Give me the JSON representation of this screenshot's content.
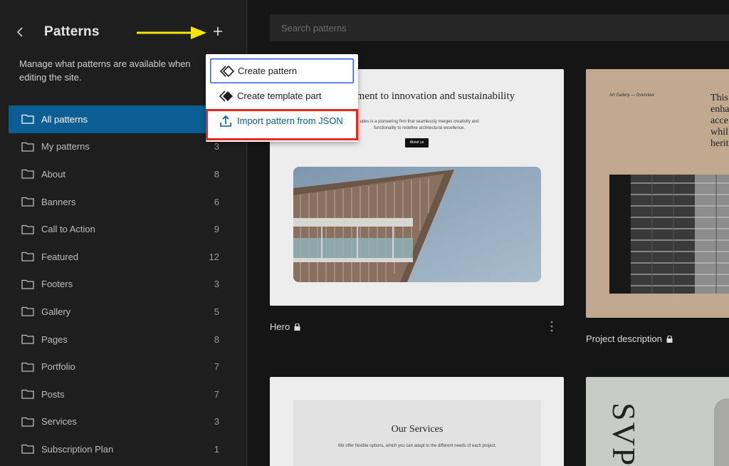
{
  "sidebar": {
    "back_icon": "chevron-left-icon",
    "title": "Patterns",
    "add_icon": "plus-icon",
    "description": "Manage what patterns are available when editing the site.",
    "items": [
      {
        "label": "All patterns",
        "count": "",
        "active": true
      },
      {
        "label": "My patterns",
        "count": "3"
      },
      {
        "label": "About",
        "count": "8"
      },
      {
        "label": "Banners",
        "count": "6"
      },
      {
        "label": "Call to Action",
        "count": "9"
      },
      {
        "label": "Featured",
        "count": "12"
      },
      {
        "label": "Footers",
        "count": "3"
      },
      {
        "label": "Gallery",
        "count": "5"
      },
      {
        "label": "Pages",
        "count": "8"
      },
      {
        "label": "Portfolio",
        "count": "7"
      },
      {
        "label": "Posts",
        "count": "7"
      },
      {
        "label": "Services",
        "count": "3"
      },
      {
        "label": "Subscription Plan",
        "count": "1"
      }
    ]
  },
  "annotation": {
    "arrow_color": "#f7e600",
    "highlight_color": "#e8271f"
  },
  "dropdown": {
    "items": [
      {
        "label": "Create pattern",
        "icon": "pattern-icon"
      },
      {
        "label": "Create template part",
        "icon": "template-part-icon"
      },
      {
        "label": "Import pattern from JSON",
        "icon": "upload-icon"
      }
    ]
  },
  "main": {
    "search_placeholder": "Search patterns",
    "cards": {
      "hero": {
        "label": "Hero",
        "heading": "commitment to innovation and sustainability",
        "sub": "udes is a pioneering firm that seamlessly merges creativity and functionality to redefine architectural excellence.",
        "button": "About us"
      },
      "project": {
        "label": "Project description",
        "kicker": "Art Gallery — Overview",
        "text_lines": [
          "This",
          "enha",
          "acce",
          "whil",
          "herit"
        ]
      },
      "services": {
        "heading": "Our Services",
        "sub": "We offer flexible options, which you can adapt to the different needs of each project."
      },
      "svp": {
        "text": "SVP"
      }
    }
  },
  "colors": {
    "accent": "#0a5e94",
    "sidebar_bg": "#1e1e1e",
    "main_bg": "#151515"
  }
}
